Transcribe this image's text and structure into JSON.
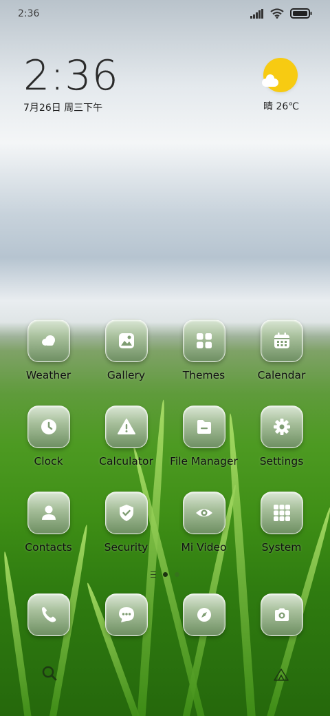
{
  "status_bar": {
    "time": "2:36",
    "icons": [
      "signal-icon",
      "wifi-icon",
      "battery-icon"
    ]
  },
  "clock_widget": {
    "time": "2:36",
    "date": "7月26日 周三下午"
  },
  "weather_widget": {
    "icon": "sunny-with-cloud-icon",
    "text": "晴 26℃",
    "sun_color": "#f7cb12"
  },
  "apps": [
    {
      "label": "Weather",
      "icon": "weather-icon"
    },
    {
      "label": "Gallery",
      "icon": "gallery-icon"
    },
    {
      "label": "Themes",
      "icon": "themes-icon"
    },
    {
      "label": "Calendar",
      "icon": "calendar-icon"
    },
    {
      "label": "Clock",
      "icon": "clock-icon"
    },
    {
      "label": "Calculator",
      "icon": "warning-icon"
    },
    {
      "label": "File Manager",
      "icon": "folder-icon"
    },
    {
      "label": "Settings",
      "icon": "gear-icon"
    },
    {
      "label": "Contacts",
      "icon": "person-icon"
    },
    {
      "label": "Security",
      "icon": "shield-icon"
    },
    {
      "label": "Mi Video",
      "icon": "eye-icon"
    },
    {
      "label": "System",
      "icon": "folder-grid-icon"
    }
  ],
  "dock": [
    {
      "icon": "phone-icon"
    },
    {
      "icon": "message-icon"
    },
    {
      "icon": "compass-icon"
    },
    {
      "icon": "camera-icon"
    }
  ],
  "pager": {
    "pages": 2,
    "current": 1
  },
  "bottom": {
    "left_icon": "search-icon",
    "right_icon": "mi-logo-icon"
  },
  "colors": {
    "icon_tile": "#a8c09c",
    "glyph": "#ffffff"
  }
}
